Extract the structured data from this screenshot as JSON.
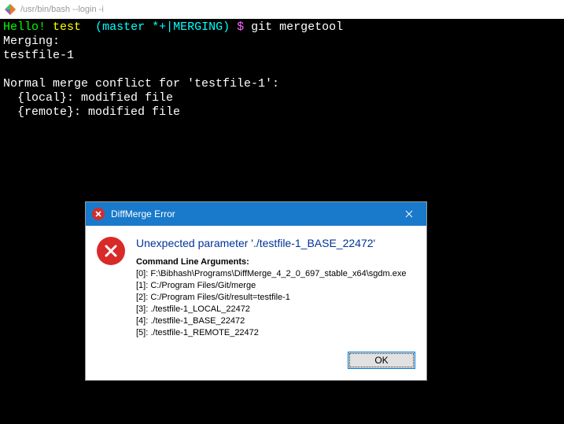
{
  "titlebar": {
    "title": "/usr/bin/bash --login -i"
  },
  "terminal": {
    "prompt": {
      "hello": "Hello!",
      "dir": "test",
      "branch": "(master *+|MERGING)",
      "dollar": "$",
      "command": "git mergetool"
    },
    "lines": {
      "merging": "Merging:",
      "file1": "testfile-1",
      "blank1": "",
      "conflict": "Normal merge conflict for 'testfile-1':",
      "local": "  {local}: modified file",
      "remote": "  {remote}: modified file"
    }
  },
  "dialog": {
    "title": "DiffMerge Error",
    "heading": "Unexpected parameter './testfile-1_BASE_22472'",
    "args_label": "Command Line Arguments:",
    "args": [
      "[0]: F:\\Bibhash\\Programs\\DiffMerge_4_2_0_697_stable_x64\\sgdm.exe",
      "[1]: C:/Program Files/Git/merge",
      "[2]: C:/Program Files/Git/result=testfile-1",
      "[3]: ./testfile-1_LOCAL_22472",
      "[4]: ./testfile-1_BASE_22472",
      "[5]: ./testfile-1_REMOTE_22472"
    ],
    "ok_label": "OK"
  }
}
